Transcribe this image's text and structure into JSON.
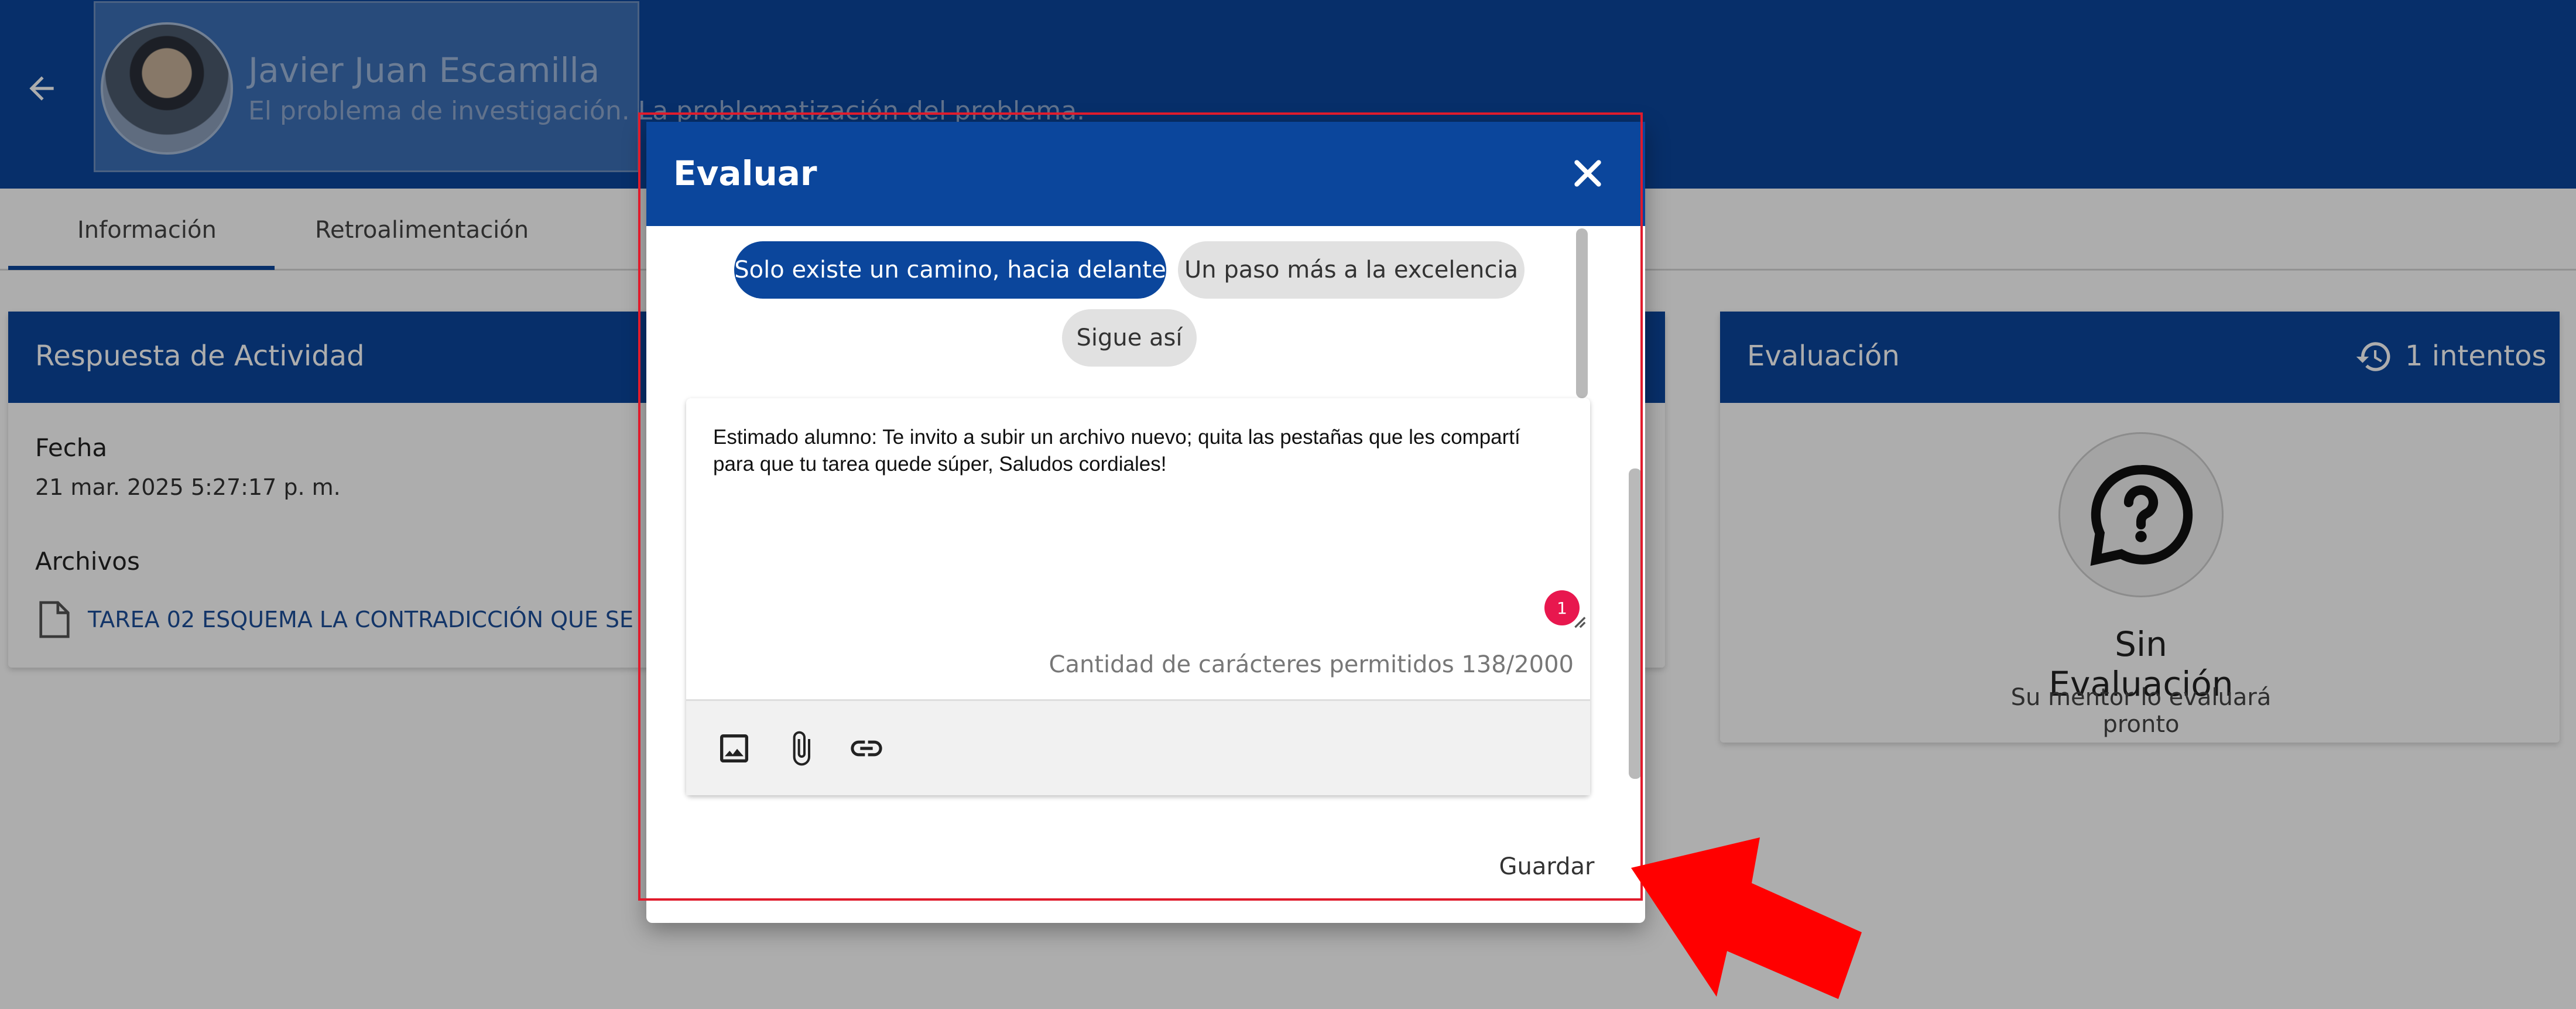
{
  "header": {
    "profile_name": "Javier Juan Escamilla",
    "profile_subtitle": "El problema de investigación. La problematización del problema.",
    "back_icon": "arrow-left-icon"
  },
  "tabs": [
    {
      "label": "Información",
      "active": true
    },
    {
      "label": "Retroalimentación",
      "active": false
    }
  ],
  "activity_card": {
    "title": "Respuesta de Actividad",
    "date_label": "Fecha",
    "date_value": "21 mar. 2025 5:27:17 p. m.",
    "files_label": "Archivos",
    "file_name": "TAREA 02 ESQUEMA LA CONTRADICCIÓN QUE SE"
  },
  "evaluation_card": {
    "title": "Evaluación",
    "attempts": "1 intentos",
    "status_title": "Sin Evaluación",
    "status_subtitle": "Su mentor lo evaluará pronto"
  },
  "dialog": {
    "title": "Evaluar",
    "chips": [
      {
        "label": "Solo existe un camino, hacia delante",
        "selected": true
      },
      {
        "label": "Un paso más a la excelencia",
        "selected": false
      },
      {
        "label": "Sigue así",
        "selected": false
      }
    ],
    "editor_text": "Estimado alumno: Te invito a subir un archivo nuevo; quita las pestañas que les compartí para que tu tarea quede súper, Saludos cordiales!",
    "badge_count": "1",
    "char_count": "Cantidad de carácteres permitidos 138/2000",
    "toolbar_icons": [
      "image-icon",
      "attach-icon",
      "link-icon"
    ],
    "save_label": "Guardar"
  },
  "colors": {
    "brand": "#0b469c",
    "badge": "#e8174e",
    "annotation": "#e01b2c"
  }
}
